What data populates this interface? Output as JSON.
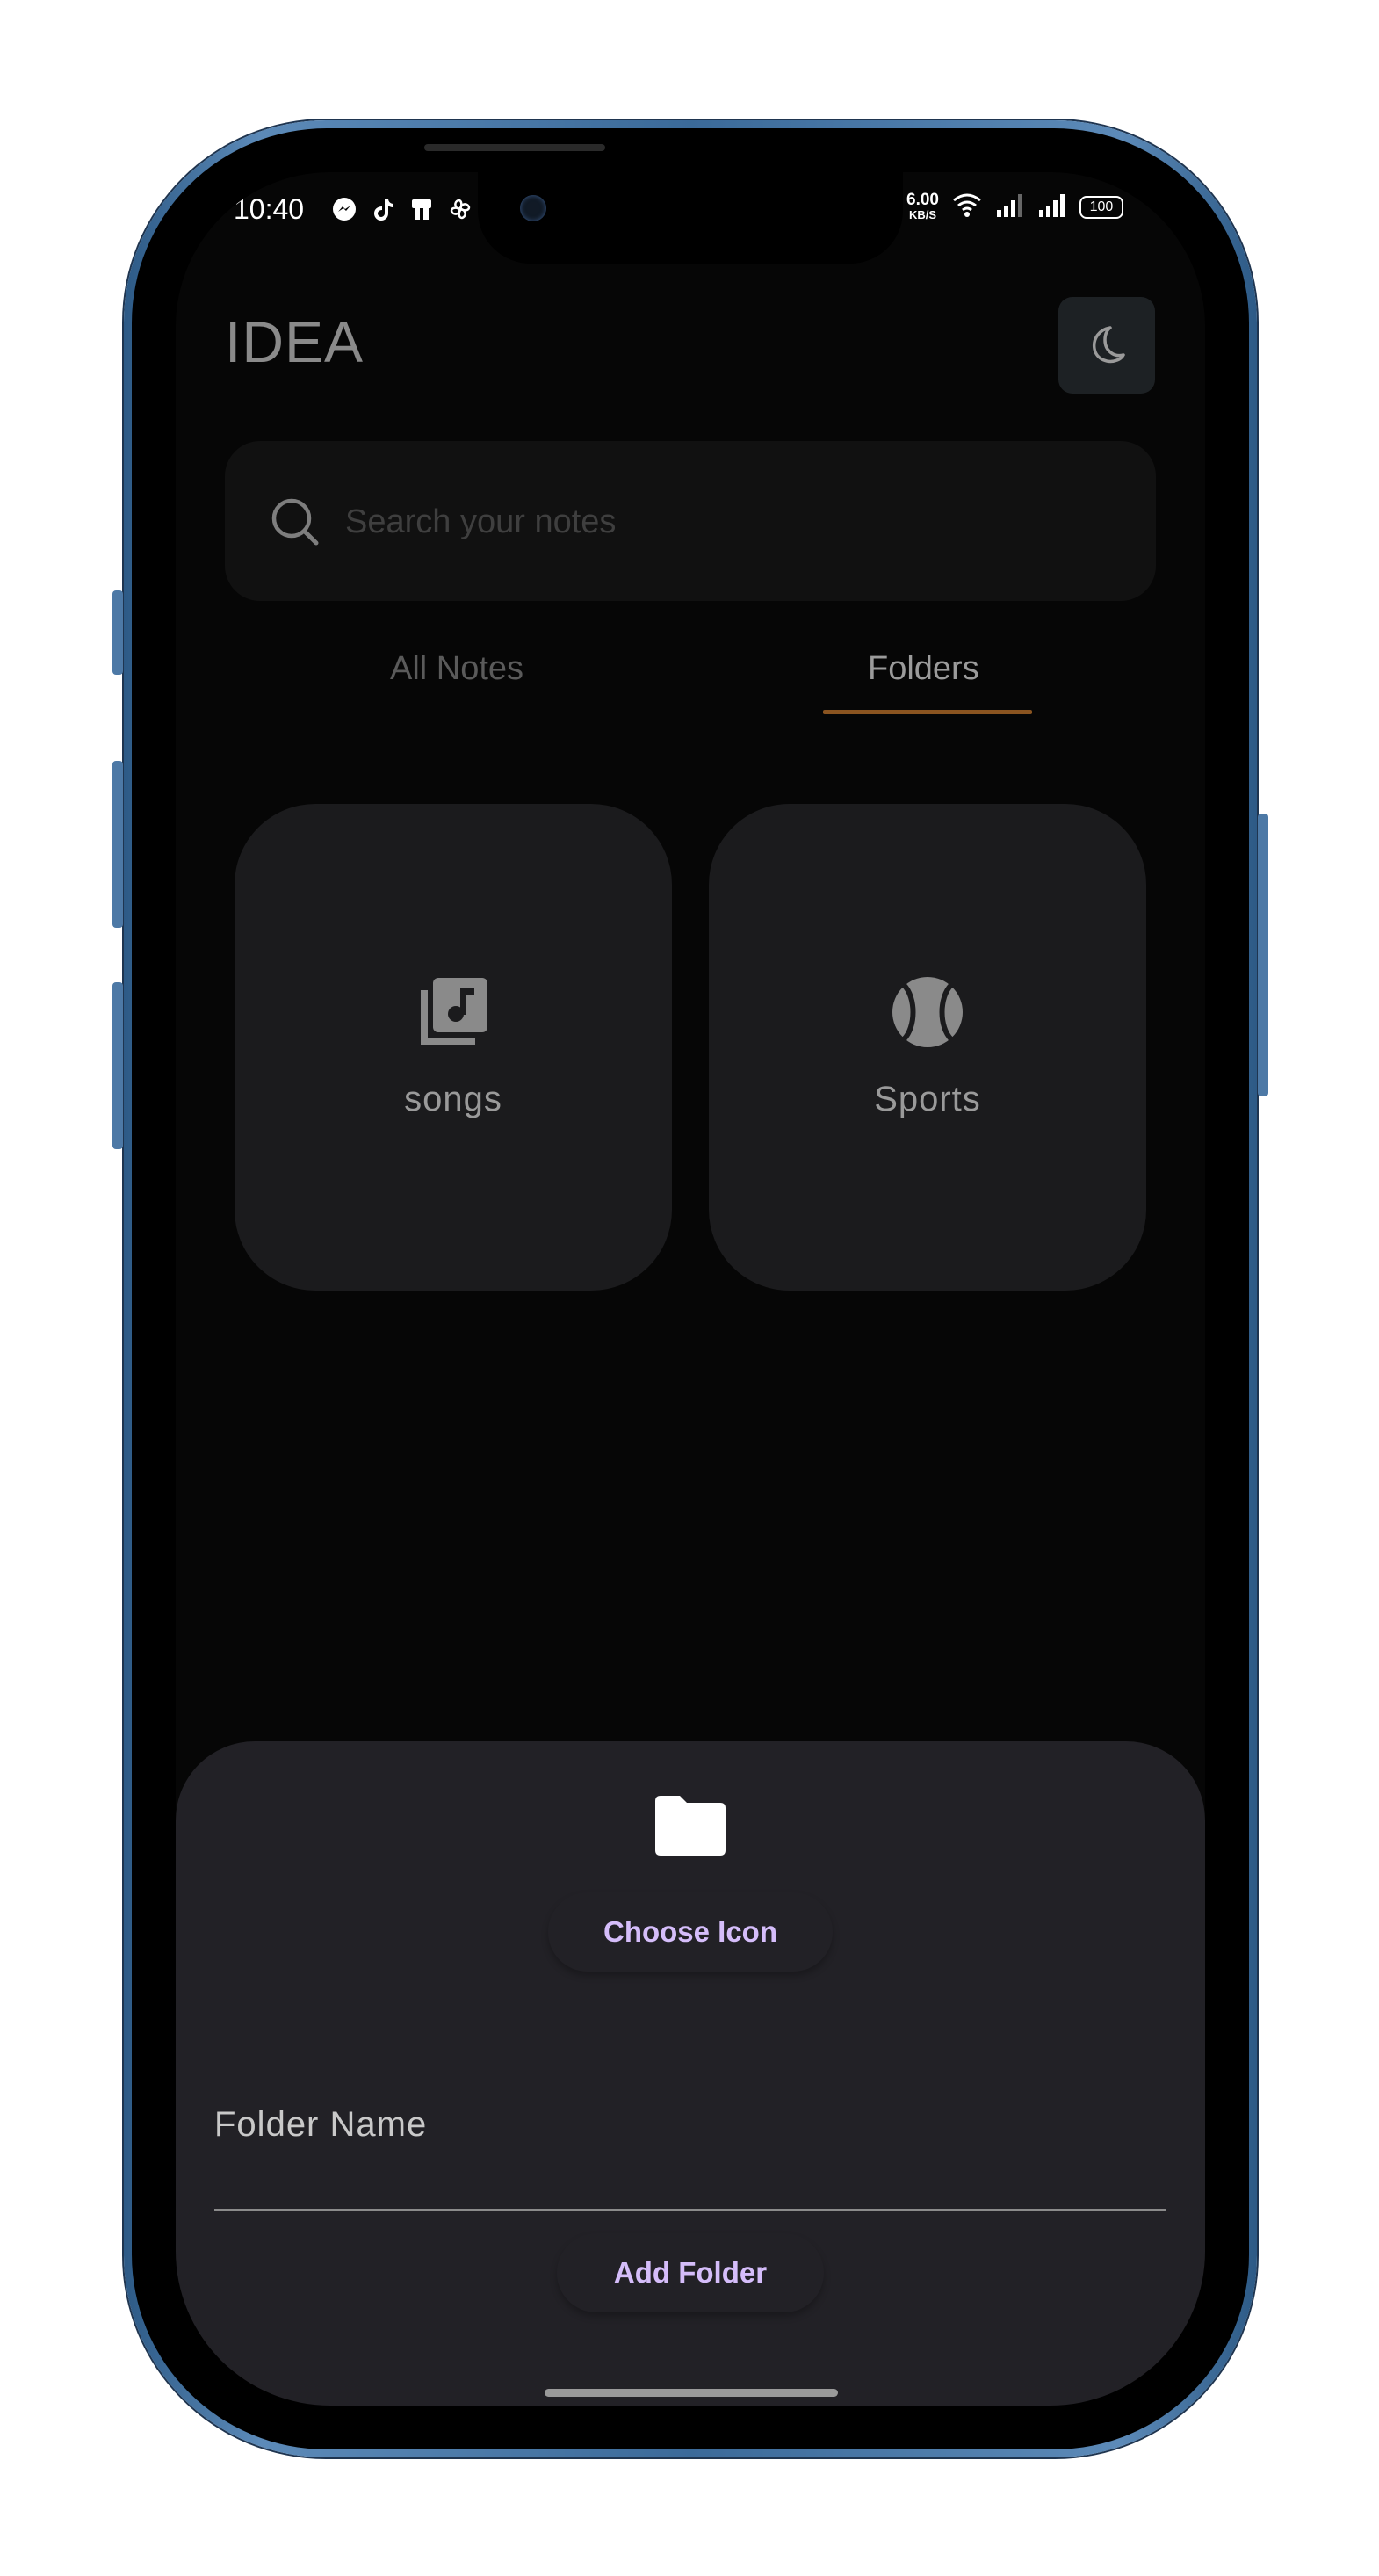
{
  "status_bar": {
    "time": "10:40",
    "speed_value": "6.00",
    "speed_unit": "KB/S",
    "battery": "100"
  },
  "header": {
    "title": "IDEA",
    "theme_toggle_icon": "moon-icon"
  },
  "search": {
    "placeholder": "Search your notes",
    "value": ""
  },
  "tabs": [
    {
      "label": "All Notes",
      "active": false
    },
    {
      "label": "Folders",
      "active": true
    }
  ],
  "accent_color": "#8a5420",
  "folders": [
    {
      "name": "songs",
      "icon": "library-music-icon"
    },
    {
      "name": "Sports",
      "icon": "sports-ball-icon"
    }
  ],
  "sheet": {
    "icon": "folder-icon",
    "choose_icon_label": "Choose Icon",
    "folder_name_label": "Folder Name",
    "folder_name_value": "",
    "add_button_label": "Add Folder",
    "button_text_color": "#d5bdfa"
  }
}
